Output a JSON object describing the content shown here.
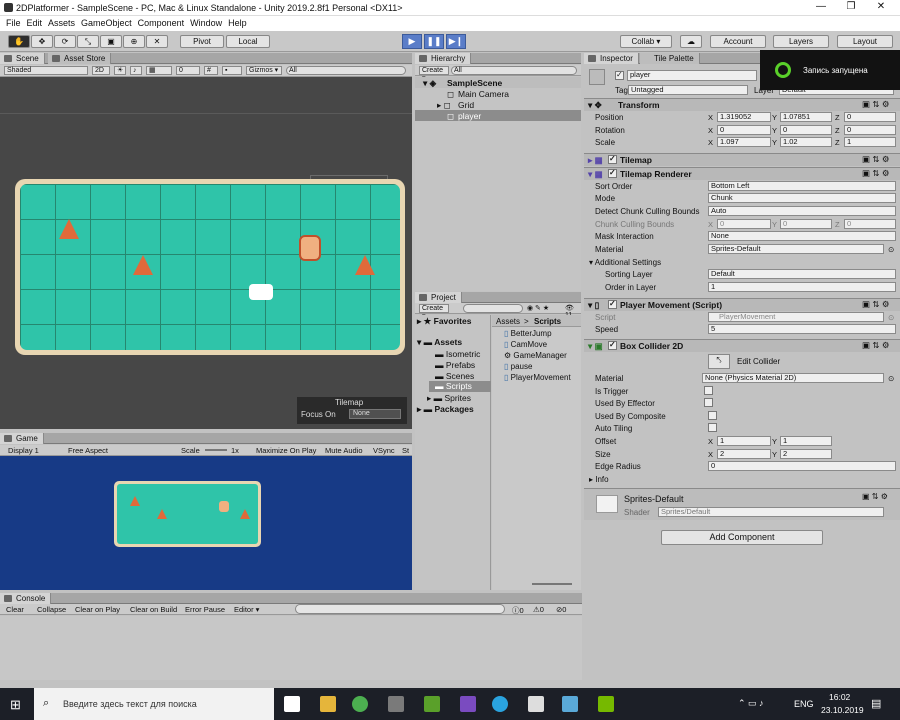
{
  "window": {
    "title": "2DPlatformer - SampleScene - PC, Mac & Linux Standalone - Unity 2019.2.8f1 Personal <DX11>",
    "minimize": "—",
    "maximize": "❐",
    "close": "✕"
  },
  "menu": [
    "File",
    "Edit",
    "Assets",
    "GameObject",
    "Component",
    "Window",
    "Help"
  ],
  "toolbar": {
    "pivot": "Pivot",
    "local": "Local",
    "play": "▶",
    "pause": "❚❚",
    "step": "▶❙",
    "collab": "Collab ▾",
    "account": "Account",
    "layers": "Layers",
    "layout": "Layout"
  },
  "scene": {
    "tab": "Scene",
    "tab2": "Asset Store",
    "shaded": "Shaded",
    "mode2d": "2D",
    "gizmos": "Gizmos ▾",
    "search": "All",
    "zero": "0",
    "tilemap_panel": {
      "title": "Tilemap",
      "focus_label": "Focus On",
      "focus_value": "None"
    }
  },
  "game": {
    "tab": "Game",
    "display": "Display 1",
    "aspect": "Free Aspect",
    "scale": "Scale",
    "scale_val": "1x",
    "maximize": "Maximize On Play",
    "mute": "Mute Audio",
    "vsync": "VSync",
    "stats": "St"
  },
  "console": {
    "tab": "Console",
    "clear": "Clear",
    "collapse": "Collapse",
    "clear_on_play": "Clear on Play",
    "clear_on_build": "Clear on Build",
    "error_pause": "Error Pause",
    "editor": "Editor ▾",
    "counts": [
      "0",
      "0",
      "0"
    ]
  },
  "hierarchy": {
    "tab": "Hierarchy",
    "create": "Create ▾",
    "search": "All",
    "scene": "SampleScene",
    "items": [
      "Main Camera",
      "Grid",
      "player"
    ]
  },
  "project": {
    "tab": "Project",
    "create": "Create ▾",
    "count": "11",
    "favorites": "Favorites",
    "assets": "Assets",
    "packages": "Packages",
    "folders": [
      "Isometric",
      "Prefabs",
      "Scenes",
      "Scripts",
      "Sprites"
    ],
    "breadcrumb": [
      "Assets",
      ">",
      "Scripts"
    ],
    "files": [
      "BetterJump",
      "CamMove",
      "GameManager",
      "pause",
      "PlayerMovement"
    ]
  },
  "inspector": {
    "tab": "Inspector",
    "tab2": "Tile Palette",
    "object": "player",
    "tag_label": "Tag",
    "tag": "Untagged",
    "layer_label": "Layer",
    "layer": "Default",
    "transform": {
      "title": "Transform",
      "position": {
        "label": "Position",
        "x": "1.319052",
        "y": "1.07851",
        "z": "0"
      },
      "rotation": {
        "label": "Rotation",
        "x": "0",
        "y": "0",
        "z": "0"
      },
      "scale": {
        "label": "Scale",
        "x": "1.097",
        "y": "1.02",
        "z": "1"
      }
    },
    "tilemap": "Tilemap",
    "renderer": {
      "title": "Tilemap Renderer",
      "rows": [
        {
          "label": "Sort Order",
          "value": "Bottom Left"
        },
        {
          "label": "Mode",
          "value": "Chunk"
        },
        {
          "label": "Detect Chunk Culling Bounds",
          "value": "Auto"
        }
      ],
      "chunk_label": "Chunk Culling Bounds",
      "chunk": {
        "x": "0",
        "y": "0",
        "z": "0"
      },
      "mask_label": "Mask Interaction",
      "mask": "None",
      "material_label": "Material",
      "material": "Sprites-Default",
      "additional": "Additional Settings",
      "sorting_layer_label": "Sorting Layer",
      "sorting_layer": "Default",
      "order_label": "Order in Layer",
      "order": "1"
    },
    "movement": {
      "title": "Player Movement (Script)",
      "script_label": "Script",
      "script": "PlayerMovement",
      "speed_label": "Speed",
      "speed": "5"
    },
    "collider": {
      "title": "Box Collider 2D",
      "edit": "Edit Collider",
      "material_label": "Material",
      "material": "None (Physics Material 2D)",
      "is_trigger": "Is Trigger",
      "used_by_effector": "Used By Effector",
      "used_by_composite": "Used By Composite",
      "auto_tiling": "Auto Tiling",
      "offset_label": "Offset",
      "offset": {
        "x": "1",
        "y": "1"
      },
      "size_label": "Size",
      "size": {
        "x": "2",
        "y": "2"
      },
      "edge_label": "Edge Radius",
      "edge": "0",
      "info": "Info"
    },
    "material_preview": {
      "name": "Sprites-Default",
      "shader_label": "Shader",
      "shader": "Sprites/Default"
    },
    "add_component": "Add Component"
  },
  "recording": {
    "text": "Запись запущена"
  },
  "taskbar": {
    "search": "Введите здесь текст для поиска",
    "lang": "ENG",
    "time": "16:02",
    "date": "23.10.2019"
  },
  "colors": {
    "accent": "#5a7dc8",
    "water": "#2fc4a9",
    "game_bg": "#173a86",
    "taskbar": "#1c1f27"
  }
}
